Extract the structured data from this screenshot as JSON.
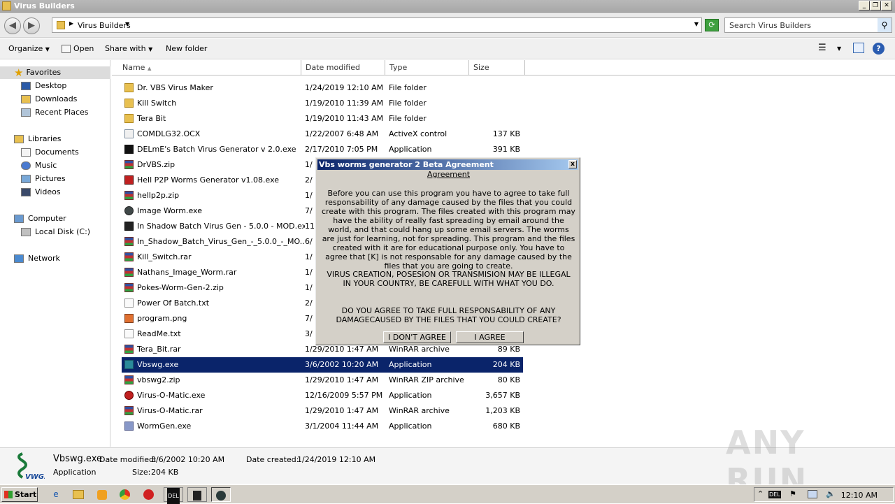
{
  "window": {
    "title": "Virus Builders",
    "minimize": "_",
    "maximize": "❐",
    "close": "✕"
  },
  "address": {
    "breadcrumb": "Virus Builders",
    "search_placeholder": "Search Virus Builders"
  },
  "toolbar": {
    "organize": "Organize",
    "open": "Open",
    "share_with": "Share with",
    "new_folder": "New folder"
  },
  "sidebar": {
    "favorites": "Favorites",
    "desktop": "Desktop",
    "downloads": "Downloads",
    "recent_places": "Recent Places",
    "libraries": "Libraries",
    "documents": "Documents",
    "music": "Music",
    "pictures": "Pictures",
    "videos": "Videos",
    "computer": "Computer",
    "local_disk": "Local Disk (C:)",
    "network": "Network"
  },
  "columns": {
    "name": "Name",
    "date": "Date modified",
    "type": "Type",
    "size": "Size"
  },
  "files": [
    {
      "name": "Dr. VBS Virus Maker",
      "date": "1/24/2019 12:10 AM",
      "type": "File folder",
      "size": "",
      "icon": "folder"
    },
    {
      "name": "Kill Switch",
      "date": "1/19/2010 11:39 AM",
      "type": "File folder",
      "size": "",
      "icon": "folder"
    },
    {
      "name": "Tera Bit",
      "date": "1/19/2010 11:43 AM",
      "type": "File folder",
      "size": "",
      "icon": "folder"
    },
    {
      "name": "COMDLG32.OCX",
      "date": "1/22/2007 6:48 AM",
      "type": "ActiveX control",
      "size": "137 KB",
      "icon": "ocx"
    },
    {
      "name": "DELmE's Batch Virus Generator v 2.0.exe",
      "date": "2/17/2010 7:05 PM",
      "type": "Application",
      "size": "391 KB",
      "icon": "del"
    },
    {
      "name": "DrVBS.zip",
      "date": "1/",
      "type": "",
      "size": "",
      "icon": "rar"
    },
    {
      "name": "Hell P2P Worms Generator v1.08.exe",
      "date": "2/",
      "type": "",
      "size": "",
      "icon": "hell"
    },
    {
      "name": "hellp2p.zip",
      "date": "1/",
      "type": "",
      "size": "",
      "icon": "rar"
    },
    {
      "name": "Image Worm.exe",
      "date": "7/",
      "type": "",
      "size": "",
      "icon": "alien"
    },
    {
      "name": "In Shadow Batch Virus Gen - 5.0.0 - MOD.exe",
      "date": "11",
      "type": "",
      "size": "",
      "icon": "bin"
    },
    {
      "name": "In_Shadow_Batch_Virus_Gen_-_5.0.0_-_MO...",
      "date": "6/",
      "type": "",
      "size": "",
      "icon": "rar"
    },
    {
      "name": "Kill_Switch.rar",
      "date": "1/",
      "type": "",
      "size": "",
      "icon": "rar"
    },
    {
      "name": "Nathans_Image_Worm.rar",
      "date": "1/",
      "type": "",
      "size": "",
      "icon": "rar"
    },
    {
      "name": "Pokes-Worm-Gen-2.zip",
      "date": "1/",
      "type": "",
      "size": "",
      "icon": "rar"
    },
    {
      "name": "Power Of Batch.txt",
      "date": "2/",
      "type": "",
      "size": "",
      "icon": "txt"
    },
    {
      "name": "program.png",
      "date": "7/",
      "type": "",
      "size": "",
      "icon": "png"
    },
    {
      "name": "ReadMe.txt",
      "date": "3/",
      "type": "",
      "size": "",
      "icon": "txt"
    },
    {
      "name": "Tera_Bit.rar",
      "date": "1/29/2010 1:47 AM",
      "type": "WinRAR archive",
      "size": "89 KB",
      "icon": "rar"
    },
    {
      "name": "Vbswg.exe",
      "date": "3/6/2002 10:20 AM",
      "type": "Application",
      "size": "204 KB",
      "icon": "vbs",
      "selected": true
    },
    {
      "name": "vbswg2.zip",
      "date": "1/29/2010 1:47 AM",
      "type": "WinRAR ZIP archive",
      "size": "80 KB",
      "icon": "rar"
    },
    {
      "name": "Virus-O-Matic.exe",
      "date": "12/16/2009 5:57 PM",
      "type": "Application",
      "size": "3,657 KB",
      "icon": "vom"
    },
    {
      "name": "Virus-O-Matic.rar",
      "date": "1/29/2010 1:47 AM",
      "type": "WinRAR archive",
      "size": "1,203 KB",
      "icon": "rar"
    },
    {
      "name": "WormGen.exe",
      "date": "3/1/2004 11:44 AM",
      "type": "Application",
      "size": "680 KB",
      "icon": "worm"
    }
  ],
  "details": {
    "name": "Vbswg.exe",
    "date_modified_label": "Date modified:",
    "date_modified": "3/6/2002 10:20 AM",
    "date_created_label": "Date created:",
    "date_created": "1/24/2019 12:10 AM",
    "type": "Application",
    "size_label": "Size:",
    "size": "204 KB",
    "logo_text": "VWG2"
  },
  "dialog": {
    "title": "Vbs worms generator 2 Beta Agreement",
    "close": "x",
    "heading": "Agreement",
    "paragraph1": "Before you can use this program you have to agree to take full responsability of any damage caused by the files that you could create with this program. The files created with this program may have the ability of really fast spreading by email around the world, and that could hang up some email servers. The worms are just for learning, not for spreading. This program and the files created with it are for educational purpose only. You have to agree that [K] is not responsable for any damage caused by the files that you are going to create.",
    "paragraph2": "VIRUS CREATION, POSESION OR TRANSMISION MAY BE ILLEGAL IN YOUR COUNTRY, BE CAREFULL WITH WHAT YOU DO.",
    "paragraph3": "DO YOU AGREE TO TAKE FULL RESPONSABILITY OF ANY DAMAGECAUSED BY THE FILES THAT YOU COULD CREATE?",
    "disagree": "I DON'T AGREE",
    "agree": "I AGREE"
  },
  "taskbar": {
    "start": "Start",
    "clock": "12:10 AM"
  },
  "watermark": "ANY RUN"
}
